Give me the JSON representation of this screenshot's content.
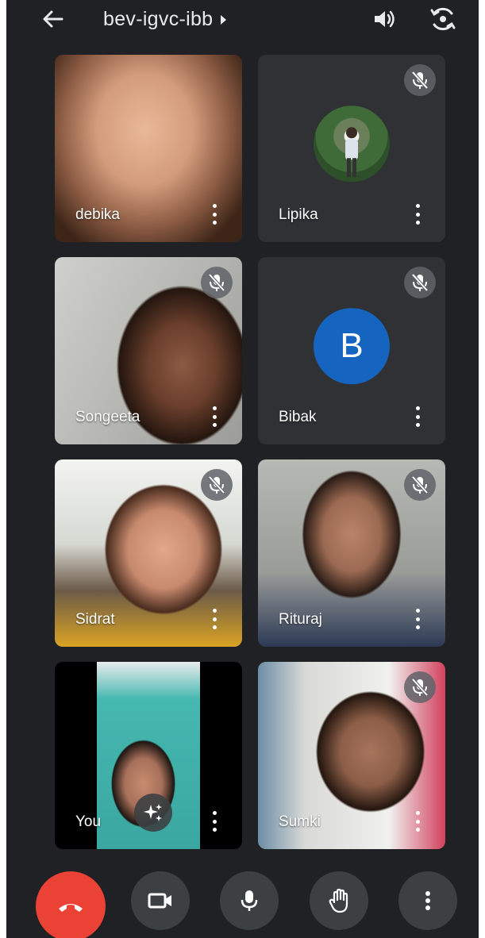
{
  "header": {
    "meeting_code": "bev-igvc-ibb",
    "icons": [
      "back-arrow-icon",
      "caret-right-icon",
      "speaker-icon",
      "switch-camera-icon"
    ]
  },
  "participants": [
    {
      "name": "debika",
      "muted": false,
      "video": true
    },
    {
      "name": "Lipika",
      "muted": true,
      "video": false,
      "avatar": "photo"
    },
    {
      "name": "Songeeta",
      "muted": true,
      "video": true
    },
    {
      "name": "Bibak",
      "muted": true,
      "video": false,
      "avatar_letter": "B"
    },
    {
      "name": "Sidrat",
      "muted": true,
      "video": true
    },
    {
      "name": "Rituraj",
      "muted": true,
      "video": true
    },
    {
      "name": "You",
      "muted": false,
      "video": true,
      "self": true
    },
    {
      "name": "Sumki",
      "muted": true,
      "video": true
    }
  ],
  "controls": [
    {
      "name": "end-call",
      "icon": "phone-hangup-icon",
      "color": "#ea4335"
    },
    {
      "name": "camera",
      "icon": "video-camera-icon"
    },
    {
      "name": "microphone",
      "icon": "microphone-icon"
    },
    {
      "name": "raise-hand",
      "icon": "hand-icon"
    },
    {
      "name": "more-options",
      "icon": "more-vertical-icon"
    }
  ],
  "colors": {
    "background": "#202124",
    "tile_audio": "#303134",
    "avatar_blue": "#1565c0",
    "end_call_red": "#ea4335",
    "control_grey": "#3c4043"
  }
}
